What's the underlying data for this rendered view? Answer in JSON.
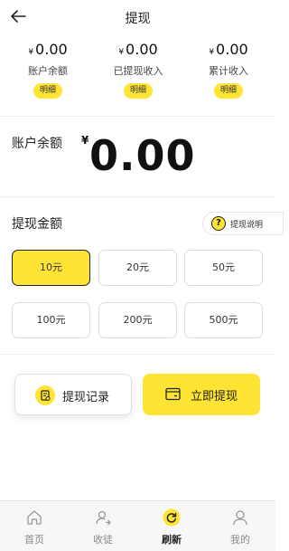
{
  "header": {
    "title": "提现"
  },
  "stats": [
    {
      "currency": "¥",
      "amount": "0.00",
      "label": "账户余额",
      "detail": "明细"
    },
    {
      "currency": "¥",
      "amount": "0.00",
      "label": "已提现收入",
      "detail": "明细"
    },
    {
      "currency": "¥",
      "amount": "0.00",
      "label": "累计收入",
      "detail": "明细"
    }
  ],
  "balance": {
    "label": "账户余额",
    "currency": "¥",
    "value": "0.00"
  },
  "withdraw": {
    "title": "提现金额",
    "help_label": "提现说明",
    "help_icon_text": "?",
    "amounts": [
      "10元",
      "20元",
      "50元",
      "100元",
      "200元",
      "500元"
    ],
    "selected": "10元"
  },
  "actions": {
    "records_label": "提现记录",
    "withdraw_label": "立即提现"
  },
  "tabbar": [
    {
      "label": "首页",
      "icon": "home-icon"
    },
    {
      "label": "收徒",
      "icon": "recruit-icon"
    },
    {
      "label": "刷新",
      "icon": "refresh-icon"
    },
    {
      "label": "我的",
      "icon": "profile-icon"
    }
  ],
  "colors": {
    "accent": "#ffe433",
    "text": "#222222",
    "muted": "#888888"
  }
}
